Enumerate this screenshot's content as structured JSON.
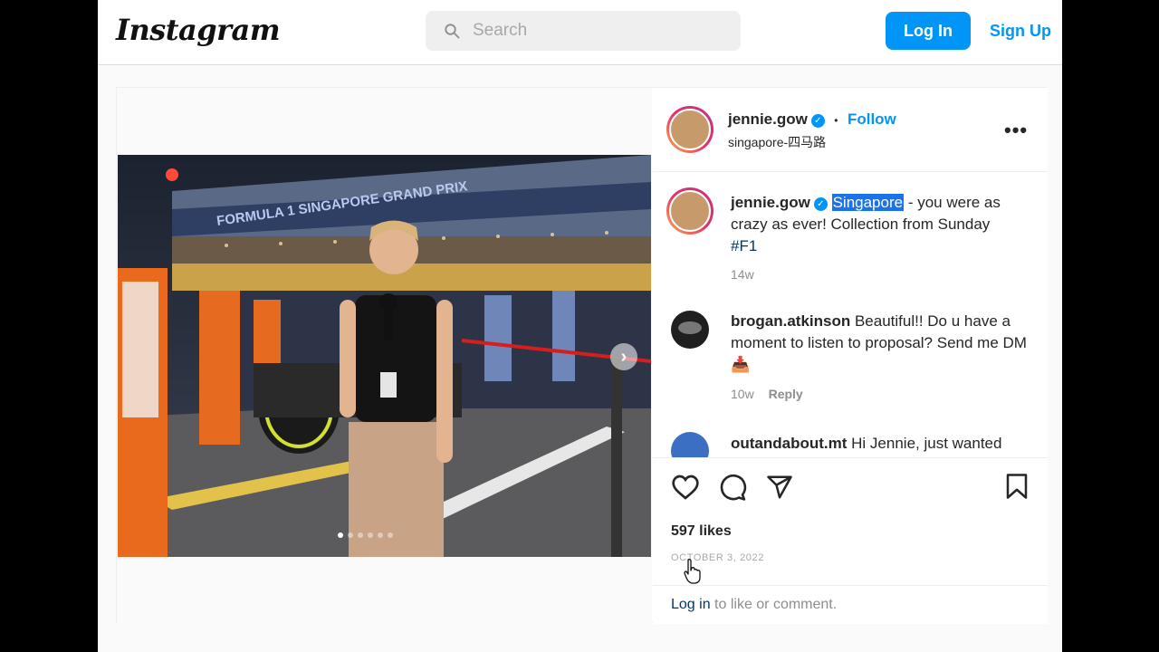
{
  "header": {
    "logo": "Instagram",
    "search_placeholder": "Search",
    "login_label": "Log In",
    "signup_label": "Sign Up"
  },
  "post": {
    "author": "jennie.gow",
    "follow_label": "Follow",
    "separator": "•",
    "location": "singapore-四马路",
    "caption": {
      "author": "jennie.gow",
      "mention": "Singapore",
      "text_1": " - you were as crazy as ever! Collection from Sunday ",
      "hashtag": "#F1",
      "age": "14w"
    },
    "comments": [
      {
        "user": "brogan.atkinson",
        "text": " Beautiful!! Do u have a moment to listen to proposal? Send me DM 📥",
        "age": "10w",
        "reply_label": "Reply"
      },
      {
        "user": "outandabout.mt",
        "text": " Hi Jennie, just wanted"
      }
    ],
    "likes": "597 likes",
    "date": "OCTOBER 3, 2022",
    "login_prompt": {
      "link": "Log in",
      "rest": " to like or comment."
    },
    "photo": {
      "banner": "FORMULA 1 SINGAPORE GRAND PRIX",
      "dot_count": 6
    }
  },
  "colors": {
    "accent": "#0095f6",
    "highlight": "#1a73e8",
    "hashtag": "#00376b"
  },
  "icons": [
    "search-icon",
    "verified-icon",
    "more-icon",
    "heart-icon",
    "comment-icon",
    "share-icon",
    "bookmark-icon",
    "next-arrow-icon",
    "cursor-icon"
  ]
}
